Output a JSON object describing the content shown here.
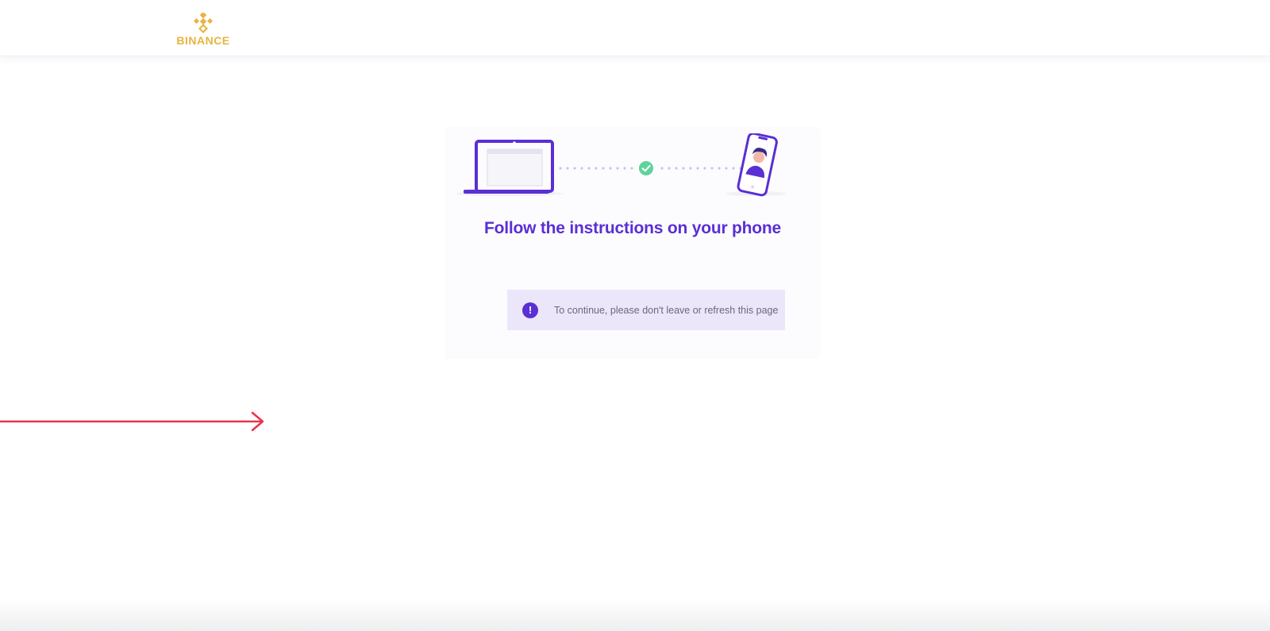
{
  "header": {
    "logo_text": "BINANCE",
    "logo_icon": "binance-diamond-icon",
    "brand_color": "#e8b440"
  },
  "main": {
    "illustration": {
      "left_icon": "laptop-icon",
      "center_icon": "check-circle-icon",
      "right_icon": "phone-selfie-icon",
      "accent_color": "#5a2fd4",
      "check_color": "#5fd39a"
    },
    "title": "Follow the instructions on your phone",
    "notice": {
      "icon": "exclamation-circle-icon",
      "text": "To continue, please don't leave or refresh this page",
      "background": "#ece6fb"
    }
  },
  "overlay": {
    "arrow_icon": "arrow-right-icon",
    "arrow_color": "#e8344c"
  }
}
